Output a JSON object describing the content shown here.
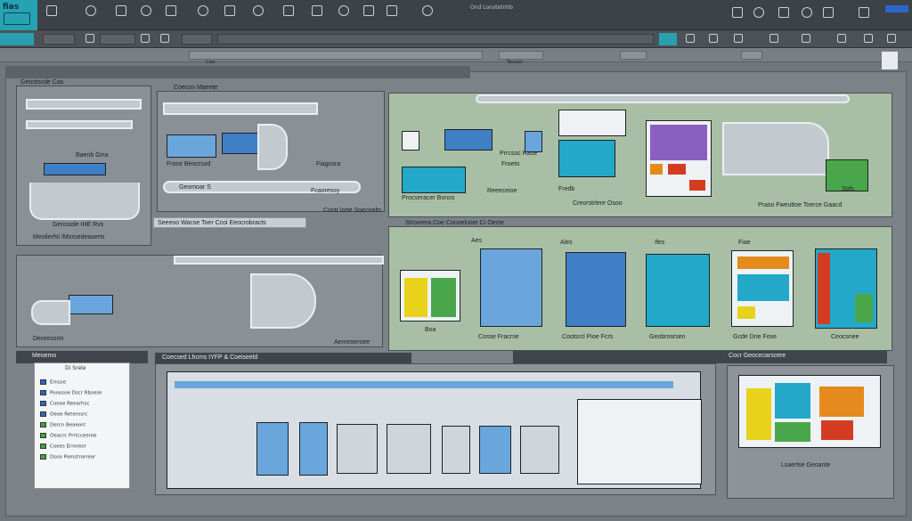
{
  "toolbar": {
    "logo_text": "fias",
    "tab_label": "Ond Lonstetnhb"
  },
  "panels": {
    "top_left_title": "Geootscde Cas",
    "top_left_label1": "Baenb Grra",
    "top_left_label2": "Genssole IHE Rvs",
    "top_left_label3": "Meolierfsl /Moroedeaserts",
    "top_mid_title": "Coecon Maeete",
    "top_mid_label1": "Froce Beocrsod",
    "top_mid_label2": "Geomoar S",
    "top_mid_label3": "Fiagosra",
    "top_mid_label4": "Fcaoressy",
    "top_mid_label5": "Contr lorte Soecnelts",
    "top_mid_bar": "Seeeoo Wacse Toer Ccoi Eeocrobracts",
    "top_right_label1": "Prrcsoc Raoe",
    "top_right_label2": "Procseracer Bonos",
    "top_right_label3": "Froeto",
    "top_right_label4": "Reeeceioe",
    "top_right_label5": "Creorstrlere Osoo",
    "top_right_label6": "Fredb",
    "top_right_label7": "Praso Fweuttoe Toerce Gaacd",
    "top_right_label8": "Sofs",
    "mid_right_title": "Stroorera Coe Conoeluser Ci Oecte",
    "mid_right_label_a": "Aes",
    "mid_right_label_b": "Ales",
    "mid_right_label_c": "Ifes",
    "mid_right_label_d": "Fiae",
    "mid_right_bottom1": "Boa",
    "mid_right_bottom2": "Cosse Fracrse",
    "mid_right_bottom3": "Cootsrcl Pioe Fcrs",
    "mid_right_bottom4": "Geobrosrsen",
    "mid_right_bottom5": "Gcde Dne Fose",
    "mid_right_bottom6": "Ceocsnee",
    "mid_left_label1": "Deoresorm",
    "mid_left_label2": "Aemeoeroee",
    "bottom_left_title": "Meoemo",
    "bottom_left_sub": "Di Srele",
    "bottom_mid_title": "Coecsed Lhcms IYFP & Coeiseeld",
    "bottom_right_title": "Cocr Geocecarscere",
    "bottom_right_label": "Lsaerlse Geoante"
  },
  "list": [
    {
      "label": "Emsse",
      "color": "#2a66c9"
    },
    {
      "label": "Pooosoe Dscr Rbsese",
      "color": "#2a66c9"
    },
    {
      "label": "Coeoe Reearhsc",
      "color": "#2a66c9"
    },
    {
      "label": "Oeoe Reterosrc",
      "color": "#2a66c9"
    },
    {
      "label": "Dercn Beaeorc",
      "color": "#3fa33f"
    },
    {
      "label": "Oeacrc Prrtcceeroe",
      "color": "#3fa33f"
    },
    {
      "label": "Coees Erroreor",
      "color": "#3fa33f"
    },
    {
      "label": "Dsoo Pomstrorreor",
      "color": "#3fa33f"
    }
  ],
  "fields": {
    "address": "Crer",
    "search": "Tecsaln"
  }
}
